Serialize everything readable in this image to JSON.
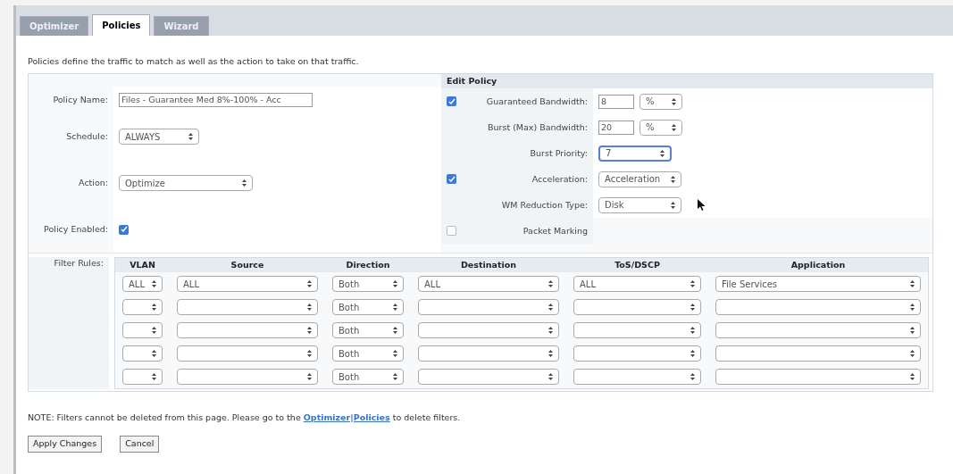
{
  "tabs": [
    {
      "label": "Optimizer",
      "selected": false
    },
    {
      "label": "Policies",
      "selected": true
    },
    {
      "label": "Wizard",
      "selected": false
    }
  ],
  "description": "Policies define the traffic to match as well as the action to take on that traffic.",
  "edit_policy": {
    "title": "Edit Policy",
    "policy_name": {
      "label": "Policy Name:",
      "value": "Files - Guarantee Med 8%-100% - Acc"
    },
    "schedule": {
      "label": "Schedule:",
      "value": "ALWAYS"
    },
    "action": {
      "label": "Action:",
      "value": "Optimize"
    },
    "policy_enabled": {
      "label": "Policy Enabled:",
      "checked": true
    },
    "options": [
      {
        "kind": "amount",
        "checked": true,
        "label": "Guaranteed Bandwidth:",
        "value": "8",
        "unit": "%"
      },
      {
        "kind": "amount",
        "label": "Burst (Max) Bandwidth:",
        "value": "20",
        "unit": "%"
      },
      {
        "kind": "select",
        "label": "Burst Priority:",
        "value": "7",
        "focused": true
      },
      {
        "kind": "select",
        "checked": true,
        "label": "Acceleration:",
        "value": "Acceleration",
        "focused": false
      },
      {
        "kind": "select",
        "label": "WM Reduction Type:",
        "value": "Disk",
        "focused": false
      },
      {
        "kind": "flag",
        "checked": false,
        "label": "Packet Marking"
      }
    ]
  },
  "filter_rules": {
    "label": "Filter Rules:",
    "columns": [
      "VLAN",
      "Source",
      "Direction",
      "Destination",
      "ToS/DSCP",
      "Application"
    ],
    "rows": [
      {
        "vlan": "ALL",
        "source": "ALL",
        "direction": "Both",
        "destination": "ALL",
        "tos_dscp": "ALL",
        "application": "File Services"
      },
      {
        "direction": "Both"
      },
      {
        "direction": "Both"
      },
      {
        "direction": "Both"
      },
      {
        "direction": "Both"
      }
    ]
  },
  "note": {
    "text": "NOTE: Filters cannot be deleted from this page. Please go to the",
    "link": "Optimizer|Policies",
    "after": "to delete filters."
  },
  "buttons": [
    "Apply Changes",
    "Cancel"
  ]
}
